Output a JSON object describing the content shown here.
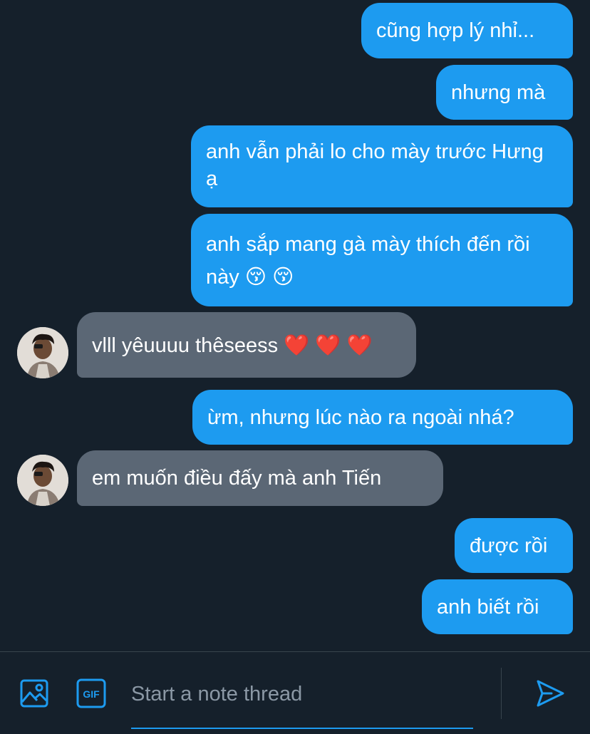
{
  "messages": [
    {
      "direction": "outgoing",
      "text": "cũng hợp lý nhỉ..."
    },
    {
      "direction": "outgoing",
      "text": "nhưng mà"
    },
    {
      "direction": "outgoing",
      "text": "anh vẫn phải lo cho mày trước Hưng ạ"
    },
    {
      "direction": "outgoing",
      "text": "anh sắp mang gà mày thích đến rồi này 😚 😚"
    },
    {
      "direction": "incoming",
      "text": "vlll yêuuuu thêseess ❤️ ❤️ ❤️"
    },
    {
      "direction": "outgoing",
      "text": "ừm, nhưng lúc nào ra ngoài nhá?"
    },
    {
      "direction": "incoming",
      "text": "em muốn điều đấy mà anh Tiến"
    },
    {
      "direction": "outgoing",
      "text": "được rồi"
    },
    {
      "direction": "outgoing",
      "text": "anh biết rồi"
    }
  ],
  "composer": {
    "placeholder": "Start a note thread",
    "media_icon": "image-icon",
    "gif_icon": "gif-icon",
    "gif_label": "GIF",
    "send_icon": "send-icon"
  },
  "colors": {
    "background": "#15202b",
    "outgoing_bubble": "#1d9bf0",
    "incoming_bubble": "#5b6775",
    "accent": "#1d9bf0",
    "placeholder": "#8b98a5",
    "border": "#38444d"
  }
}
